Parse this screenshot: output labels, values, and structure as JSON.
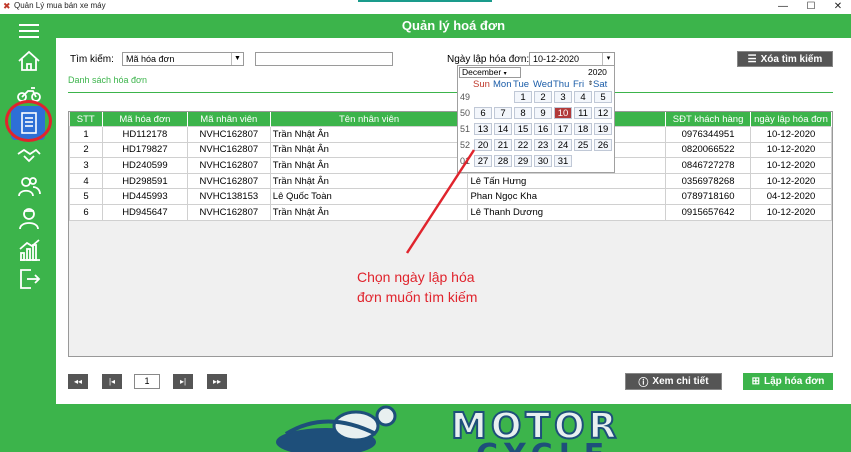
{
  "window": {
    "title": "Quản Lý mua bán xe máy",
    "minimize": "—",
    "maximize": "☐",
    "close": "✕"
  },
  "header": {
    "title": "Quản lý hoá đơn"
  },
  "filters": {
    "search_label": "Tìm kiếm:",
    "search_field_value": "Mã hóa đơn",
    "search_text_value": "",
    "date_label": "Ngày lập hóa đơn:",
    "date_value": "10-12-2020",
    "clear_button": "Xóa tìm kiếm"
  },
  "section_title": "Danh sách hóa đơn",
  "table": {
    "columns": [
      "STT",
      "Mã hóa đơn",
      "Mã nhân viên",
      "Tên nhân viên",
      "",
      "SĐT khách hàng",
      "ngày lập hóa đơn"
    ],
    "rows": [
      [
        "1",
        "HD112178",
        "NVHC162807",
        "Trần Nhật Ân",
        "",
        "0976344951",
        "10-12-2020"
      ],
      [
        "2",
        "HD179827",
        "NVHC162807",
        "Trần Nhật Ân",
        "",
        "0820066522",
        "10-12-2020"
      ],
      [
        "3",
        "HD240599",
        "NVHC162807",
        "Trần Nhật Ân",
        "",
        "0846727278",
        "10-12-2020"
      ],
      [
        "4",
        "HD298591",
        "NVHC162807",
        "Trần Nhật Ân",
        "Lê Tấn Hưng",
        "0356978268",
        "10-12-2020"
      ],
      [
        "5",
        "HD445993",
        "NVHC138153",
        "Lê Quốc Toàn",
        "Phan Ngọc Kha",
        "0789718160",
        "04-12-2020"
      ],
      [
        "6",
        "HD945647",
        "NVHC162807",
        "Trần Nhật Ân",
        "Lê Thanh Dương",
        "0915657642",
        "10-12-2020"
      ]
    ]
  },
  "calendar": {
    "month": "December",
    "year": "2020",
    "weekdays": [
      "Sun",
      "Mon",
      "Tue",
      "Wed",
      "Thu",
      "Fri",
      "Sat"
    ],
    "weeks": [
      {
        "num": "49",
        "days": [
          "",
          "",
          "1",
          "2",
          "3",
          "4",
          "5"
        ]
      },
      {
        "num": "50",
        "days": [
          "6",
          "7",
          "8",
          "9",
          "10",
          "11",
          "12"
        ]
      },
      {
        "num": "51",
        "days": [
          "13",
          "14",
          "15",
          "16",
          "17",
          "18",
          "19"
        ]
      },
      {
        "num": "52",
        "days": [
          "20",
          "21",
          "22",
          "23",
          "24",
          "25",
          "26"
        ]
      },
      {
        "num": "01",
        "days": [
          "27",
          "28",
          "29",
          "30",
          "31",
          "",
          ""
        ]
      }
    ],
    "selected_day": "10"
  },
  "annotation": {
    "line1": "Chọn ngày lập hóa",
    "line2": "đơn muốn tìm kiếm",
    "color": "#e0242d"
  },
  "pager": {
    "first": "◂◂",
    "prev": "|◂",
    "page": "1",
    "next": "▸|",
    "last": "▸▸"
  },
  "actions": {
    "details": "Xem chi tiết",
    "create": "Lập hóa đơn"
  },
  "banner": {
    "line1": "MOTOR",
    "line2": "CYCLE"
  },
  "colors": {
    "primary_green": "#3cb44b",
    "dark_button": "#555555",
    "highlight_red": "#e0242d",
    "active_blue": "#2e6fd6"
  },
  "sidebar": {
    "icons": [
      "menu-icon",
      "home-icon",
      "motorbike-icon",
      "invoice-icon",
      "handshake-icon",
      "customers-icon",
      "employee-icon",
      "statistics-icon",
      "logout-icon"
    ]
  }
}
